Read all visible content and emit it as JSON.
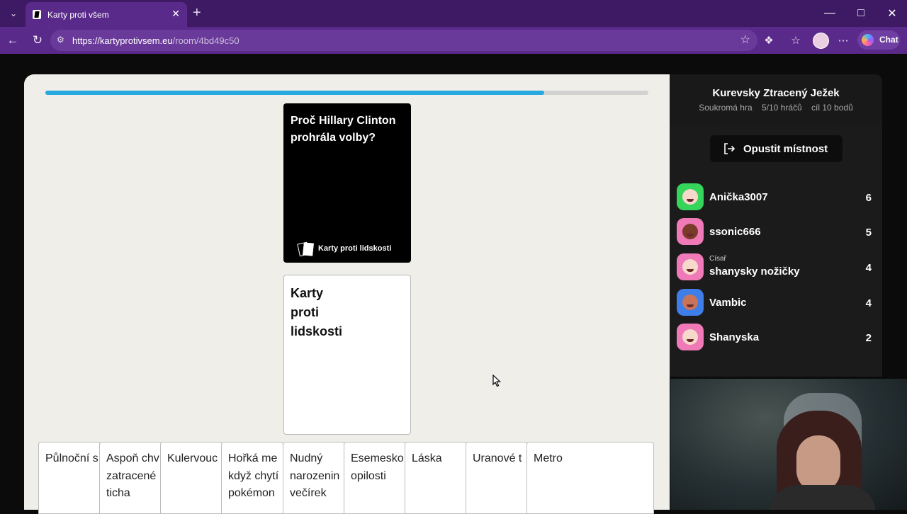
{
  "browser": {
    "tab_title": "Karty proti všem",
    "url_host": "https://kartyprotivsem.eu",
    "url_path": "/room/4bd49c50",
    "chat_label": "Chat"
  },
  "game": {
    "progress_fraction": 0.827,
    "black_card_text": "Proč Hillary Clinton prohrála volby?",
    "brand_text": "Karty proti lidskosti",
    "white_card_text": "Karty proti lidskosti",
    "hand": [
      "Půlnoční s",
      "Aspoň chv\nzatracené\nticha",
      "Kulervouc",
      "Hořká me\nkdyž chytí\npokémon",
      "Nudný\nnarozenin\nvečírek",
      "Esemesko\nopilosti",
      "Láska",
      "Uranové t",
      "Metro"
    ]
  },
  "room": {
    "title": "Kurevsky Ztracený Ježek",
    "meta": [
      "Soukromá hra",
      "5/10 hráčů",
      "cíl 10 bodů"
    ],
    "leave_label": "Opustit místnost",
    "players": [
      {
        "name": "Anička3007",
        "score": "6",
        "role": "",
        "color": "#35d45a",
        "face": "#f7d9cc"
      },
      {
        "name": "ssonic666",
        "score": "5",
        "role": "",
        "color": "#f07ab8",
        "face": "#7a3b2a"
      },
      {
        "name": "shanysky nožičky",
        "score": "4",
        "role": "Císař",
        "color": "#f07ab8",
        "face": "#f7d9cc"
      },
      {
        "name": "Vambic",
        "score": "4",
        "role": "",
        "color": "#3f7ee8",
        "face": "#c9745a"
      },
      {
        "name": "Shanyska",
        "score": "2",
        "role": "",
        "color": "#f07ab8",
        "face": "#f7d9cc"
      }
    ]
  }
}
